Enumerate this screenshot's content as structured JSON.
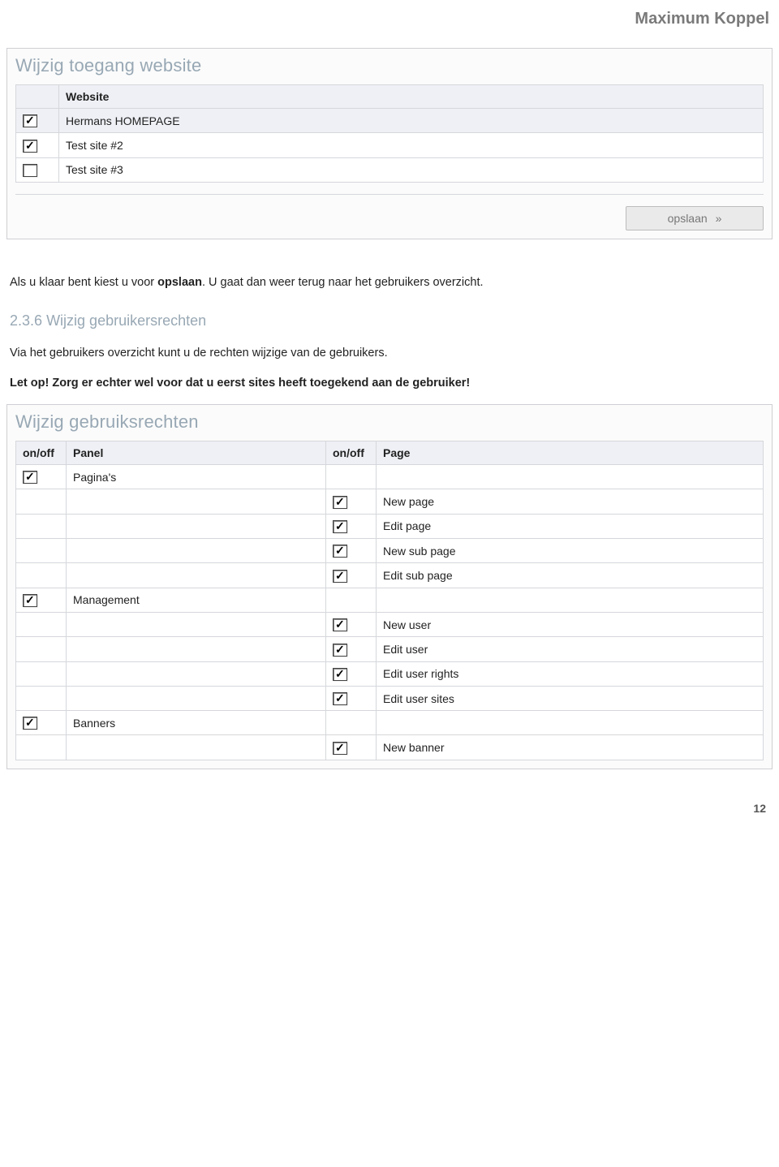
{
  "brand": "Maximum Koppel",
  "panel1": {
    "title": "Wijzig toegang website",
    "header_checkbox": "",
    "header_website": "Website",
    "rows": [
      {
        "checked": true,
        "site": "Hermans HOMEPAGE",
        "zebra": true
      },
      {
        "checked": true,
        "site": "Test site #2",
        "zebra": false
      },
      {
        "checked": false,
        "site": "Test site #3",
        "zebra": false
      }
    ],
    "save_label": "opslaan"
  },
  "prose": {
    "p1_a": "Als u klaar bent kiest u voor ",
    "p1_b": "opslaan",
    "p1_c": ". U gaat dan weer terug naar het gebruikers overzicht.",
    "section_number": "2.3.6",
    "section_title": "Wijzig gebruikersrechten",
    "p2": "Via het gebruikers overzicht kunt u de rechten wijzige van de gebruikers.",
    "p3_a": "Let op!",
    "p3_b": " Zorg er echter wel voor dat u eerst sites heeft toegekend aan de gebruiker!"
  },
  "panel2": {
    "title": "Wijzig gebruiksrechten",
    "headers": {
      "onoff1": "on/off",
      "panel": "Panel",
      "onoff2": "on/off",
      "page": "Page"
    },
    "rows": [
      {
        "panel_chk": true,
        "panel_label": "Pagina's",
        "page_chk": null,
        "page_label": ""
      },
      {
        "panel_chk": null,
        "panel_label": "",
        "page_chk": true,
        "page_label": "New page"
      },
      {
        "panel_chk": null,
        "panel_label": "",
        "page_chk": true,
        "page_label": "Edit page"
      },
      {
        "panel_chk": null,
        "panel_label": "",
        "page_chk": true,
        "page_label": "New sub page"
      },
      {
        "panel_chk": null,
        "panel_label": "",
        "page_chk": true,
        "page_label": "Edit sub page"
      },
      {
        "panel_chk": true,
        "panel_label": "Management",
        "page_chk": null,
        "page_label": ""
      },
      {
        "panel_chk": null,
        "panel_label": "",
        "page_chk": true,
        "page_label": "New user"
      },
      {
        "panel_chk": null,
        "panel_label": "",
        "page_chk": true,
        "page_label": "Edit user"
      },
      {
        "panel_chk": null,
        "panel_label": "",
        "page_chk": true,
        "page_label": "Edit user rights"
      },
      {
        "panel_chk": null,
        "panel_label": "",
        "page_chk": true,
        "page_label": "Edit user sites"
      },
      {
        "panel_chk": true,
        "panel_label": "Banners",
        "page_chk": null,
        "page_label": ""
      },
      {
        "panel_chk": null,
        "panel_label": "",
        "page_chk": true,
        "page_label": "New banner"
      }
    ]
  },
  "page_number": "12"
}
